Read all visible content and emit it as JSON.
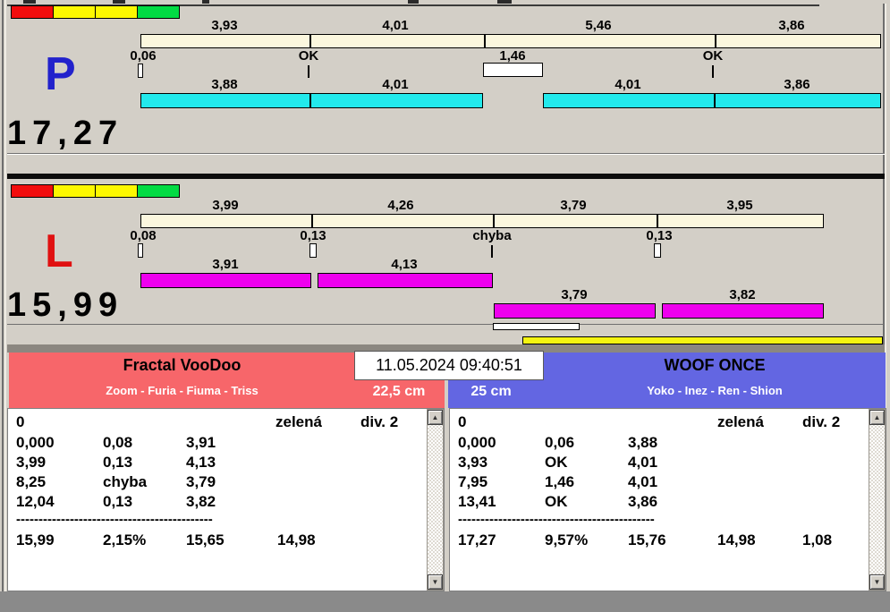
{
  "icons": {
    "scroll_up": "▲",
    "scroll_down": "▼"
  },
  "lanes": {
    "p": {
      "letter": "P",
      "total": "17,27",
      "splits": [
        "3,93",
        "4,01",
        "5,46",
        "3,86"
      ],
      "passes": [
        "0,06",
        "OK",
        "1,46",
        "OK"
      ],
      "dog_times": [
        "3,88",
        "4,01",
        "4,01",
        "3,86"
      ]
    },
    "l": {
      "letter": "L",
      "total": "15,99",
      "splits": [
        "3,99",
        "4,26",
        "3,79",
        "3,95"
      ],
      "passes": [
        "0,08",
        "0,13",
        "chyba",
        "0,13"
      ],
      "dog_times": [
        "3,91",
        "4,13",
        "3,79",
        "3,82"
      ]
    }
  },
  "footer": {
    "datetime": "11.05.2024 09:40:51",
    "left_team": {
      "name": "Fractal VooDoo",
      "dogs": "Zoom - Furia - Fiuma - Triss",
      "jump_height": "22,5 cm"
    },
    "right_team": {
      "name": "WOOF ONCE",
      "dogs": "Yoko - Inez - Ren - Shion",
      "jump_height": "25 cm"
    },
    "left_table": {
      "run": "0",
      "light": "zelená",
      "division": "div. 2",
      "rows": [
        [
          "0,000",
          "0,08",
          "3,91"
        ],
        [
          "3,99",
          "0,13",
          "4,13"
        ],
        [
          "8,25",
          "chyba",
          "3,79"
        ],
        [
          "12,04",
          "0,13",
          "3,82"
        ]
      ],
      "separator": "--------------------------------------------",
      "totals": [
        "15,99",
        "2,15%",
        "15,65",
        "14,98"
      ]
    },
    "right_table": {
      "run": "0",
      "light": "zelená",
      "division": "div. 2",
      "rows": [
        [
          "0,000",
          "0,06",
          "3,88"
        ],
        [
          "3,93",
          "OK",
          "4,01"
        ],
        [
          "7,95",
          "1,46",
          "4,01"
        ],
        [
          "13,41",
          "OK",
          "3,86"
        ]
      ],
      "separator": "--------------------------------------------",
      "totals": [
        "17,27",
        "9,57%",
        "15,76",
        "14,98",
        "1,08"
      ]
    }
  },
  "colors": {
    "background": "#D3CFC7",
    "split_bar": "#FBF7DE",
    "lane_p_bar": "#22E9EC",
    "lane_l_bar": "#EE00EE",
    "lane_p_letter": "#2222CC",
    "lane_l_letter": "#E01111",
    "team_left_bg": "#F7666A",
    "team_right_bg": "#6366E2",
    "traffic_red": "#F20D0D",
    "traffic_yellow": "#FDF800",
    "traffic_green": "#02DB43",
    "progress_yellow": "#F4F411"
  }
}
